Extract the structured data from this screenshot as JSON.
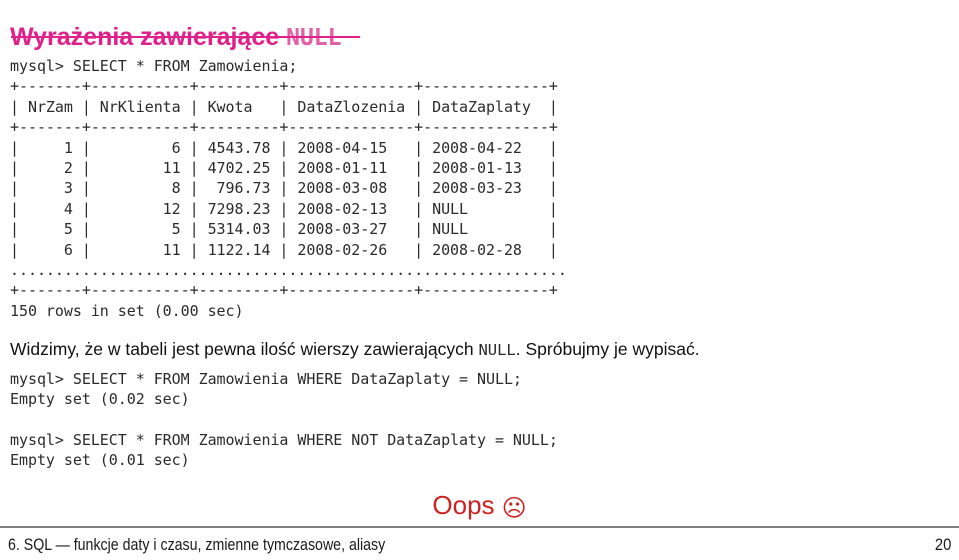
{
  "slide": {
    "title_plain": "Wyrażenia zawierające ",
    "title_mono": "NULL",
    "title_color": "#e0218a",
    "rule_color": "#e0218a"
  },
  "console_block_1": {
    "lines": [
      "mysql> SELECT * FROM Zamowienia;",
      "+-------+-----------+---------+--------------+--------------+",
      "| NrZam | NrKlienta | Kwota   | DataZlozenia | DataZaplaty  |",
      "+-------+-----------+---------+--------------+--------------+",
      "|     1 |         6 | 4543.78 | 2008-04-15   | 2008-04-22   |",
      "|     2 |        11 | 4702.25 | 2008-01-11   | 2008-01-13   |",
      "|     3 |         8 |  796.73 | 2008-03-08   | 2008-03-23   |",
      "|     4 |        12 | 7298.23 | 2008-02-13   | NULL         |",
      "|     5 |         5 | 5314.03 | 2008-03-27   | NULL         |",
      "|     6 |        11 | 1122.14 | 2008-02-26   | 2008-02-28   |",
      "..............................................................",
      "+-------+-----------+---------+--------------+--------------+",
      "150 rows in set (0.00 sec)"
    ],
    "text": "mysql> SELECT * FROM Zamowienia;\n+-------+-----------+---------+--------------+--------------+\n| NrZam | NrKlienta | Kwota   | DataZlozenia | DataZaplaty  |\n+-------+-----------+---------+--------------+--------------+\n|     1 |         6 | 4543.78 | 2008-04-15   | 2008-04-22   |\n|     2 |        11 | 4702.25 | 2008-01-11   | 2008-01-13   |\n|     3 |         8 |  796.73 | 2008-03-08   | 2008-03-23   |\n|     4 |        12 | 7298.23 | 2008-02-13   | NULL         |\n|     5 |         5 | 5314.03 | 2008-03-27   | NULL         |\n|     6 |        11 | 1122.14 | 2008-02-26   | 2008-02-28   |\n..............................................................\n+-------+-----------+---------+--------------+--------------+\n150 rows in set (0.00 sec)"
  },
  "result_table": {
    "headers": [
      "NrZam",
      "NrKlienta",
      "Kwota",
      "DataZlozenia",
      "DataZaplaty"
    ],
    "rows": [
      [
        "1",
        "6",
        "4543.78",
        "2008-04-15",
        "2008-04-22"
      ],
      [
        "2",
        "11",
        "4702.25",
        "2008-01-11",
        "2008-01-13"
      ],
      [
        "3",
        "8",
        "796.73",
        "2008-03-08",
        "2008-03-23"
      ],
      [
        "4",
        "12",
        "7298.23",
        "2008-02-13",
        "NULL"
      ],
      [
        "5",
        "5",
        "5314.03",
        "2008-03-27",
        "NULL"
      ],
      [
        "6",
        "11",
        "1122.14",
        "2008-02-26",
        "2008-02-28"
      ]
    ],
    "truncation_marker": "..............................................................",
    "status": "150 rows in set (0.00 sec)"
  },
  "prose": {
    "before": "Widzimy, że w tabeli jest pewna ilość wierszy zawierających ",
    "mono": "NULL",
    "after": ". Spróbujmy je wypisać."
  },
  "console_block_2": {
    "text": "mysql> SELECT * FROM Zamowienia WHERE DataZaplaty = NULL;\nEmpty set (0.02 sec)",
    "query": "mysql> SELECT * FROM Zamowienia WHERE DataZaplaty = NULL;",
    "status": "Empty set (0.02 sec)"
  },
  "console_block_3": {
    "text": "mysql> SELECT * FROM Zamowienia WHERE NOT DataZaplaty = NULL;\nEmpty set (0.01 sec)",
    "query": "mysql> SELECT * FROM Zamowienia WHERE NOT DataZaplaty = NULL;",
    "status": "Empty set (0.01 sec)"
  },
  "oops": {
    "text": "Oops",
    "face_icon": "frowning-face-icon",
    "face_glyph": "☹",
    "color": "#cc2222"
  },
  "footer": {
    "title": "6. SQL — funkcje daty i czasu, zmienne tymczasowe, aliasy",
    "page": "20"
  }
}
